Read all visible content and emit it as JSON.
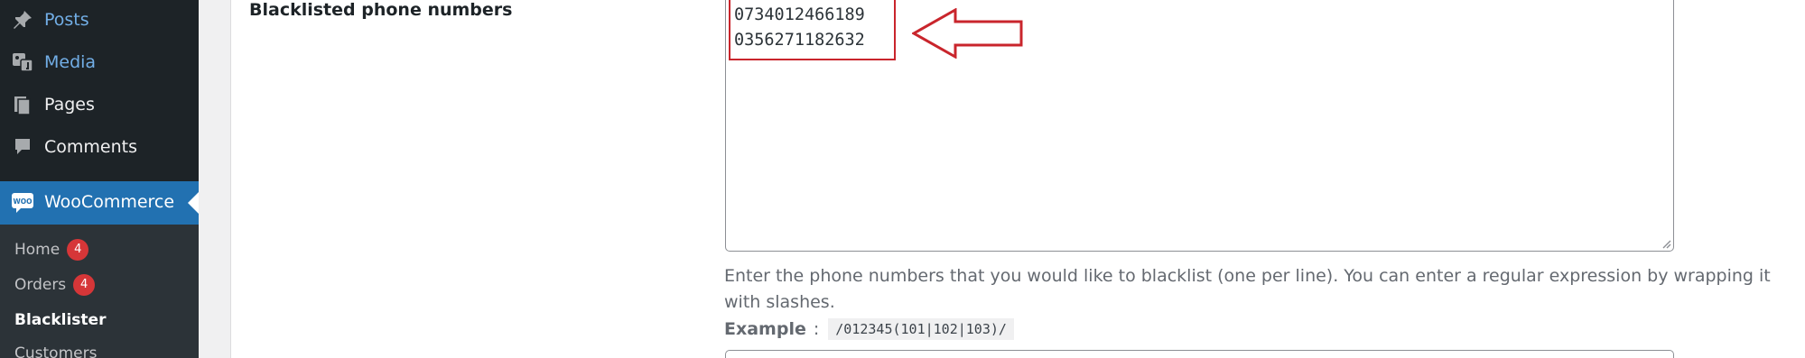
{
  "sidebar": {
    "menu": [
      {
        "label": "Posts",
        "icon": "pushpin-icon",
        "state": "highlight"
      },
      {
        "label": "Media",
        "icon": "media-icon",
        "state": "highlight"
      },
      {
        "label": "Pages",
        "icon": "pages-icon",
        "state": "normal"
      },
      {
        "label": "Comments",
        "icon": "comment-icon",
        "state": "normal"
      },
      {
        "label": "WooCommerce",
        "icon": "woocommerce-icon",
        "badge_text": "WOO",
        "state": "current"
      }
    ],
    "submenu": [
      {
        "label": "Home",
        "count": "4"
      },
      {
        "label": "Orders",
        "count": "4"
      },
      {
        "label": "Blacklister"
      },
      {
        "label": "Customers"
      }
    ]
  },
  "form": {
    "field_label": "Blacklisted phone numbers",
    "phone_numbers": [
      "0734012466189",
      "0356271182632"
    ],
    "description": "Enter the phone numbers that you would like to blacklist (one per line). You can enter a regular expression by wrapping it with slashes.",
    "example_label": "Example",
    "example_separator": ":",
    "example_code": "/012345(101|102|103)/"
  },
  "colors": {
    "sidebar_bg": "#1d2327",
    "submenu_bg": "#2c3338",
    "accent_blue": "#2271b1",
    "link_blue": "#72aee6",
    "badge_red": "#d63638",
    "annotation_red": "#c9252c"
  }
}
